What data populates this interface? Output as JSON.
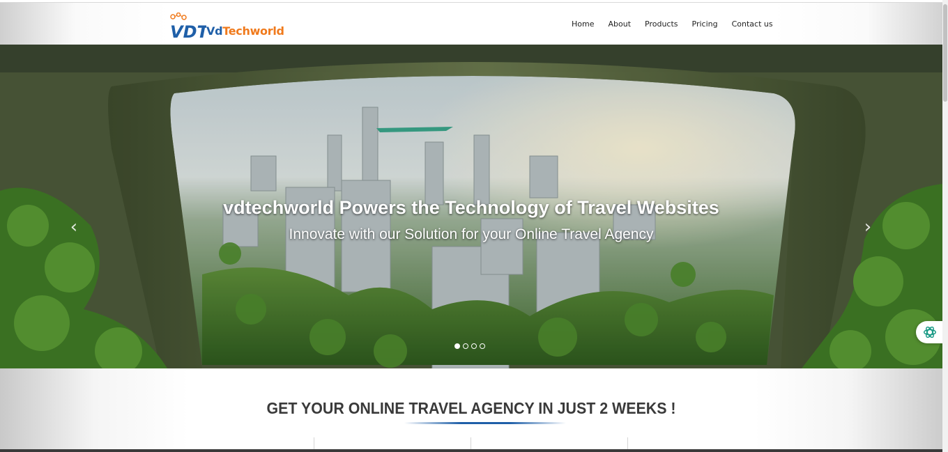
{
  "brand": {
    "mark": "VDT",
    "name_part1": "Vd",
    "name_part2": "Techworld",
    "accent_blue": "#1f5fa8",
    "accent_orange": "#f07a1c"
  },
  "nav": {
    "items": [
      {
        "label": "Home"
      },
      {
        "label": "About"
      },
      {
        "label": "Products"
      },
      {
        "label": "Pricing"
      },
      {
        "label": "Contact us"
      }
    ]
  },
  "hero": {
    "title": "vdtechworld Powers the Technology of Travel Websites",
    "subtitle": "Innovate with our Solution for your Online Travel Agency",
    "prev_icon": "chevron-left-icon",
    "next_icon": "chevron-right-icon",
    "slide_count": 4,
    "active_slide": 1
  },
  "section": {
    "heading": "GET YOUR ONLINE TRAVEL AGENCY IN JUST 2 WEEKS !"
  },
  "widget": {
    "icon": "openai-chat-icon"
  }
}
